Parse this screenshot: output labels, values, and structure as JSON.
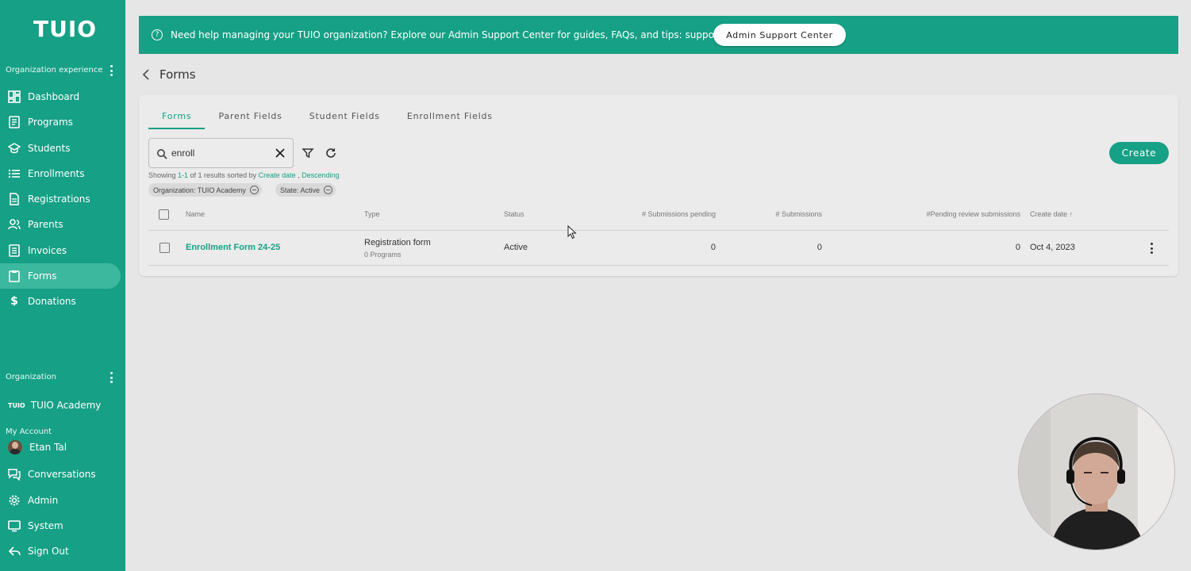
{
  "app": {
    "logo": "TUIO",
    "accent_color": "#16a085"
  },
  "sidebar": {
    "org_experience_label": "Organization experience",
    "items": [
      {
        "label": "Dashboard",
        "icon": "dashboard-icon"
      },
      {
        "label": "Programs",
        "icon": "programs-icon"
      },
      {
        "label": "Students",
        "icon": "students-icon"
      },
      {
        "label": "Enrollments",
        "icon": "enrollments-icon"
      },
      {
        "label": "Registrations",
        "icon": "registrations-icon"
      },
      {
        "label": "Parents",
        "icon": "parents-icon"
      },
      {
        "label": "Invoices",
        "icon": "invoices-icon"
      },
      {
        "label": "Forms",
        "icon": "forms-icon",
        "active": true
      },
      {
        "label": "Donations",
        "icon": "dollar-icon"
      }
    ],
    "organization_label": "Organization",
    "organization_logo": "TUIO",
    "organization_name": "TUIO Academy",
    "my_account_label": "My Account",
    "user_name": "Etan Tal",
    "bottom_items": [
      {
        "label": "Conversations",
        "icon": "conversations-icon"
      },
      {
        "label": "Admin",
        "icon": "gear-icon"
      },
      {
        "label": "System",
        "icon": "monitor-icon"
      },
      {
        "label": "Sign Out",
        "icon": "sign-out-icon"
      }
    ]
  },
  "banner": {
    "text": "Need help managing your TUIO organization? Explore our Admin Support Center for guides, FAQs, and tips: support.tuiopay.com",
    "button_label": "Admin Support Center"
  },
  "page": {
    "title": "Forms"
  },
  "tabs": [
    {
      "label": "Forms",
      "active": true
    },
    {
      "label": "Parent Fields"
    },
    {
      "label": "Student Fields"
    },
    {
      "label": "Enrollment Fields"
    }
  ],
  "search": {
    "value": "enroll"
  },
  "create_label": "Create",
  "results": {
    "showing_prefix": "Showing ",
    "range": "1-1",
    "of_text": " of 1 results sorted by ",
    "sort_field": "Create date",
    "separator": " , ",
    "sort_order": "Descending"
  },
  "filters": [
    {
      "label": "Organization: TUIO Academy"
    },
    {
      "label": "State: Active"
    }
  ],
  "table": {
    "columns": {
      "name": "Name",
      "type": "Type",
      "status": "Status",
      "pending": "# Submissions pending",
      "submissions": "# Submissions",
      "pending_review": "#Pending review submissions",
      "create_date": "Create date ↑"
    },
    "rows": [
      {
        "name": "Enrollment Form 24-25",
        "type": "Registration form",
        "programs": "0 Programs",
        "status": "Active",
        "pending": "0",
        "submissions": "0",
        "pending_review": "0",
        "create_date": "Oct 4, 2023"
      }
    ]
  }
}
